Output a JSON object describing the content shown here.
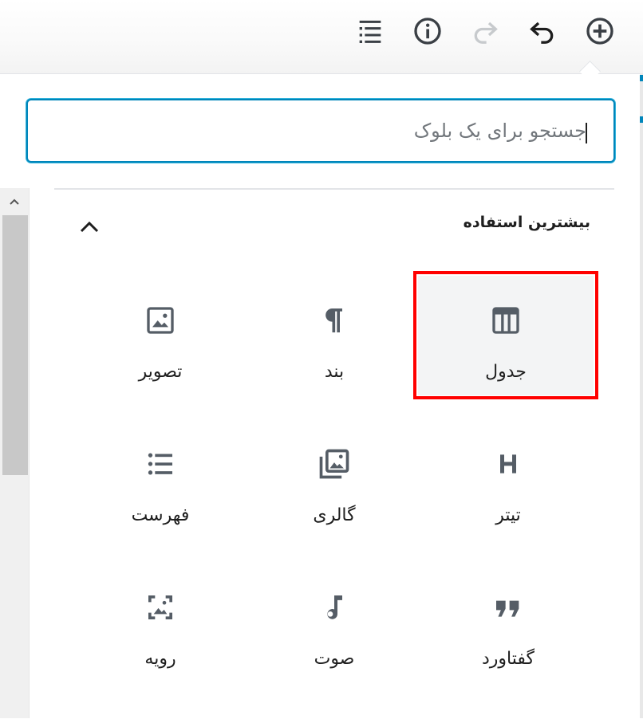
{
  "toolbar": {
    "buttons": [
      {
        "name": "add-block",
        "icon": "plus-circle-icon"
      },
      {
        "name": "undo",
        "icon": "undo-icon"
      },
      {
        "name": "redo",
        "icon": "redo-icon"
      },
      {
        "name": "info",
        "icon": "info-icon"
      },
      {
        "name": "outline",
        "icon": "outline-list-icon"
      }
    ]
  },
  "inserter": {
    "search": {
      "placeholder": "جستجو برای یک بلوک",
      "value": ""
    },
    "panel_title": "بیشترین استفاده",
    "blocks": [
      {
        "label": "جدول",
        "icon": "table-icon",
        "selected": true
      },
      {
        "label": "بند",
        "icon": "paragraph-icon"
      },
      {
        "label": "تصویر",
        "icon": "image-icon"
      },
      {
        "label": "تیتر",
        "icon": "heading-icon"
      },
      {
        "label": "گالری",
        "icon": "gallery-icon"
      },
      {
        "label": "فهرست",
        "icon": "list-icon"
      },
      {
        "label": "گفتاورد",
        "icon": "quote-icon"
      },
      {
        "label": "صوت",
        "icon": "audio-icon"
      },
      {
        "label": "رویه",
        "icon": "cover-icon"
      }
    ]
  },
  "colors": {
    "accent": "#0085ba",
    "highlight": "#ff0000",
    "icon": "#555d66"
  }
}
